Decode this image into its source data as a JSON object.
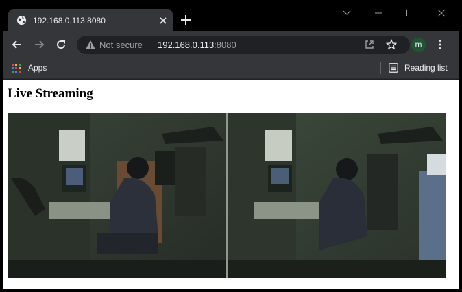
{
  "tab": {
    "title": "192.168.0.113:8080",
    "favicon": "globe-icon"
  },
  "toolbar": {
    "security_label": "Not secure",
    "url_host": "192.168.0.113",
    "url_port": ":8080",
    "profile_initial": "m"
  },
  "bookmarks": {
    "apps_label": "Apps",
    "reading_list_label": "Reading list"
  },
  "page": {
    "title": "Live Streaming"
  },
  "colors": {
    "tab_active": "#35363a",
    "titlebar": "#000000",
    "omnibox": "#202124",
    "avatar": "#1e5631",
    "page_bg": "#ffffff"
  }
}
